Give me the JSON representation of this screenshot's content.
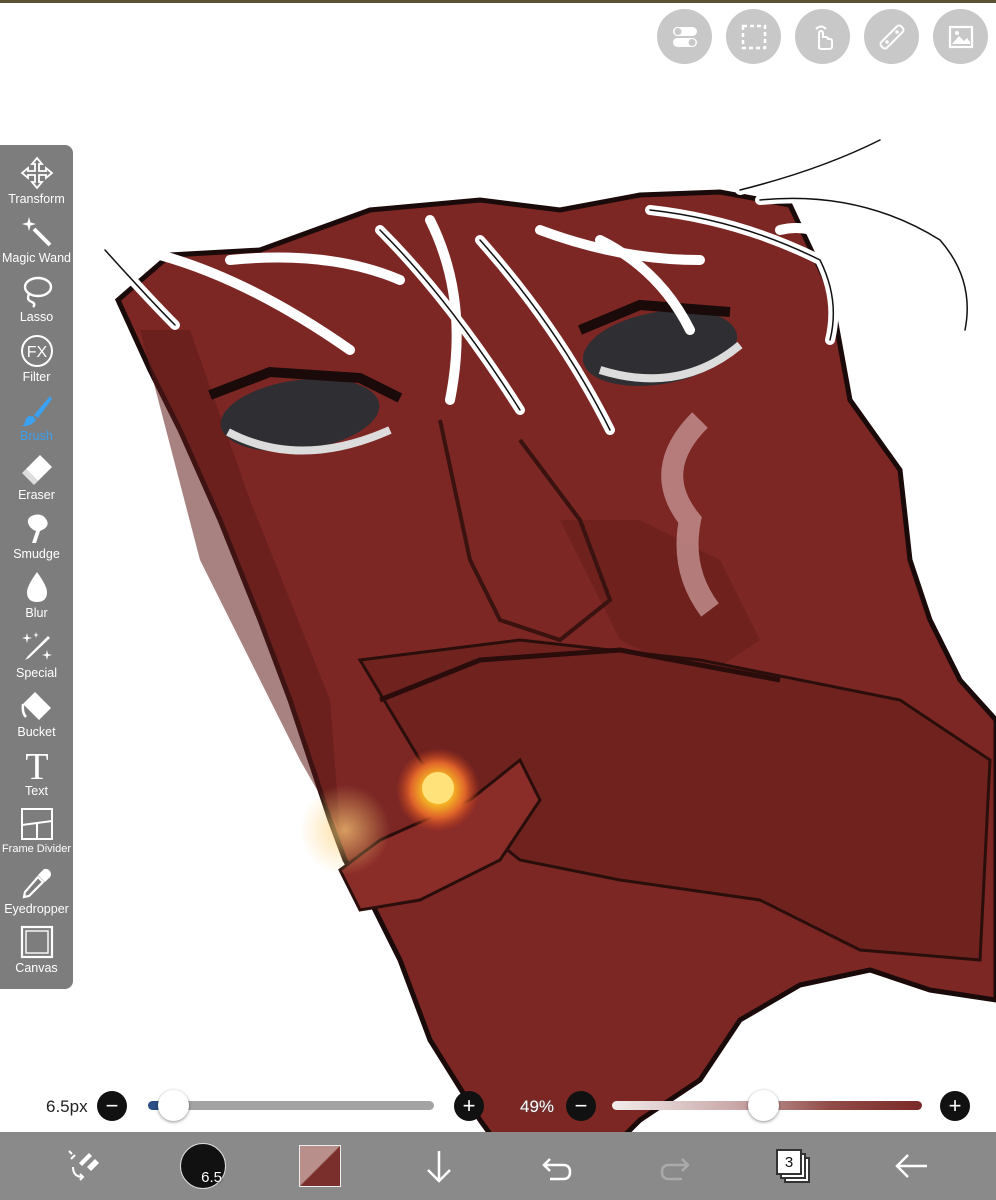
{
  "top_tools": [
    {
      "name": "toggle-icon"
    },
    {
      "name": "selection-icon"
    },
    {
      "name": "gesture-hand-icon"
    },
    {
      "name": "ruler-icon"
    },
    {
      "name": "reference-image-icon"
    }
  ],
  "toolbar": {
    "items": [
      {
        "label": "Transform",
        "icon": "move-arrows-icon"
      },
      {
        "label": "Magic Wand",
        "icon": "magic-wand-icon"
      },
      {
        "label": "Lasso",
        "icon": "lasso-icon"
      },
      {
        "label": "Filter",
        "icon": "fx-icon",
        "icon_text": "FX"
      },
      {
        "label": "Brush",
        "icon": "brush-icon",
        "active": true
      },
      {
        "label": "Eraser",
        "icon": "eraser-icon"
      },
      {
        "label": "Smudge",
        "icon": "smudge-icon"
      },
      {
        "label": "Blur",
        "icon": "droplet-icon"
      },
      {
        "label": "Special",
        "icon": "sparkle-pen-icon"
      },
      {
        "label": "Bucket",
        "icon": "bucket-icon"
      },
      {
        "label": "Text",
        "icon": "text-icon",
        "icon_text": "T"
      },
      {
        "label": "Frame Divider",
        "icon": "frame-divider-icon"
      },
      {
        "label": "Eyedropper",
        "icon": "eyedropper-icon"
      },
      {
        "label": "Canvas",
        "icon": "canvas-icon"
      }
    ],
    "active_color": "#3aa0f0"
  },
  "sliders": {
    "size_label": "6.5px",
    "size_fraction": 0.09,
    "opacity_label": "49%",
    "opacity_fraction": 0.49,
    "minus": "−",
    "plus": "+"
  },
  "bottom_bar": {
    "brush_size": "6.5",
    "layers_count": "3",
    "primary_color": "#7a2f2c",
    "secondary_color": "#b88f8a"
  }
}
